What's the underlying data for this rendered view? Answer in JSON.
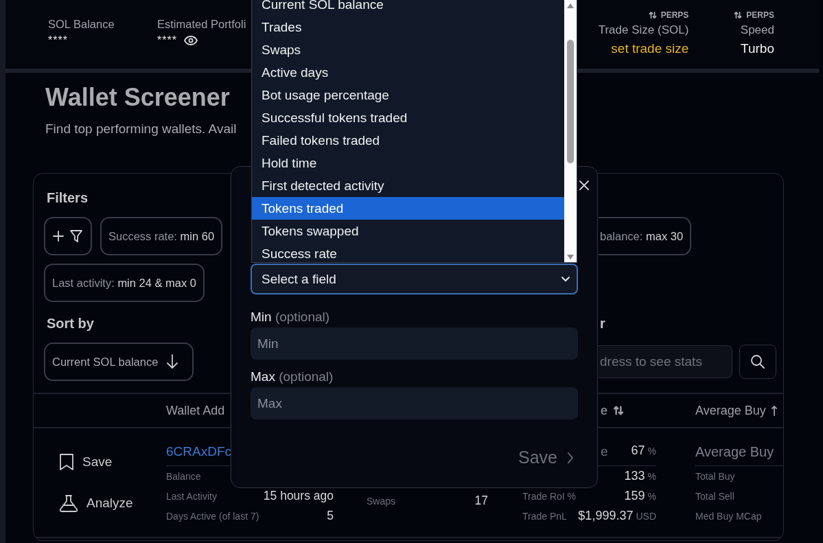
{
  "header": {
    "stats": [
      {
        "label": "SOL Balance",
        "value": "****",
        "hidden_toggle": false
      },
      {
        "label": "Estimated Portfoli",
        "value": "****",
        "hidden_toggle": true
      }
    ],
    "perps": [
      {
        "tag": "PERPS",
        "label": "Trade Size (SOL)",
        "value": "set trade size",
        "kind": "link"
      },
      {
        "tag": "PERPS",
        "label": "Speed",
        "value": "Turbo",
        "kind": "plain"
      }
    ]
  },
  "page": {
    "title": "Wallet Screener",
    "subtitle": "Find top performing wallets. Avail"
  },
  "filters": {
    "heading": "Filters",
    "rows": [
      {
        "chips": [
          {
            "label": "Success rate:",
            "value": "min 60",
            "kind": "full"
          },
          {
            "label": "balance:",
            "value": "max 30",
            "kind": "cut"
          }
        ]
      },
      {
        "chips": [
          {
            "label": "Last activity:",
            "value": "min 24 & max 0",
            "kind": "full"
          }
        ]
      }
    ]
  },
  "sort": {
    "heading": "Sort by",
    "value": "Current SOL balance"
  },
  "search": {
    "heading": "r",
    "placeholder": "dress to see stats"
  },
  "table": {
    "columns": [
      {
        "label": "Wallet Add",
        "kind": "plain"
      },
      {
        "label": "e",
        "kind": "sortable"
      },
      {
        "label": "Average Buy",
        "kind": "sorted"
      }
    ],
    "row": {
      "actions": [
        {
          "label": "Save",
          "kind": "bookmark"
        },
        {
          "label": "Analyze",
          "kind": "flask"
        }
      ],
      "address": "6CRAxDFc",
      "details": [
        {
          "label": "Balance"
        },
        {
          "label": "Last Activity",
          "value": "15 hours ago"
        },
        {
          "label": "Days Active (of last 7)",
          "value": "5"
        }
      ],
      "swaps": {
        "label": "Swaps",
        "value": "17"
      },
      "metrics": [
        {
          "label": "e",
          "value": "67",
          "unit": "%"
        },
        {
          "value": "133",
          "unit": "%"
        },
        {
          "label": "Trade RoI %",
          "value": "159",
          "unit": "%"
        },
        {
          "label": "Trade PnL",
          "value": "$1,999.37",
          "unit": "USD"
        }
      ],
      "buys": {
        "heading": "Average Buy",
        "labels": [
          "Total Buy",
          "Total Sell",
          "Med Buy MCap"
        ]
      }
    }
  },
  "modal": {
    "select": {
      "placeholder": "Select a field"
    },
    "fields": [
      {
        "label": "Min",
        "hint": "(optional)",
        "placeholder": "Min"
      },
      {
        "label": "Max",
        "hint": "(optional)",
        "placeholder": "Max"
      }
    ],
    "save": "Save"
  },
  "dropdown": {
    "options": [
      {
        "label": "Current SOL balance",
        "selected": false
      },
      {
        "label": "Trades",
        "selected": false
      },
      {
        "label": "Swaps",
        "selected": false
      },
      {
        "label": "Active days",
        "selected": false
      },
      {
        "label": "Bot usage percentage",
        "selected": false
      },
      {
        "label": "Successful tokens traded",
        "selected": false
      },
      {
        "label": "Failed tokens traded",
        "selected": false
      },
      {
        "label": "Hold time",
        "selected": false
      },
      {
        "label": "First detected activity",
        "selected": false
      },
      {
        "label": "Tokens traded",
        "selected": true
      },
      {
        "label": "Tokens swapped",
        "selected": false
      },
      {
        "label": "Success rate",
        "selected": false
      }
    ]
  }
}
